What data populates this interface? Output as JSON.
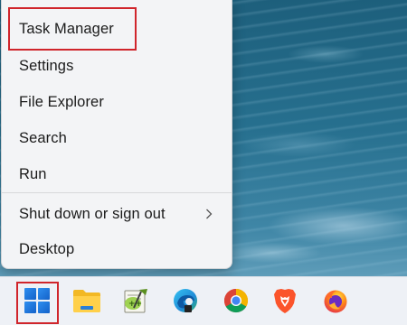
{
  "context_menu": {
    "items": [
      {
        "label": "Task Manager"
      },
      {
        "label": "Settings"
      },
      {
        "label": "File Explorer"
      },
      {
        "label": "Search"
      },
      {
        "label": "Run"
      },
      {
        "label": "Shut down or sign out",
        "icon": "chevron-right-icon"
      },
      {
        "label": "Desktop"
      }
    ],
    "highlighted_item": "Task Manager"
  },
  "taskbar": {
    "apps": [
      {
        "name": "Start",
        "icon": "windows-start-icon",
        "highlighted": true
      },
      {
        "name": "File Explorer",
        "icon": "folder-icon"
      },
      {
        "name": "Notepad++",
        "icon": "notepad-plus-plus-icon"
      },
      {
        "name": "Microsoft Edge",
        "icon": "edge-icon"
      },
      {
        "name": "Google Chrome",
        "icon": "chrome-icon"
      },
      {
        "name": "Brave",
        "icon": "brave-icon"
      },
      {
        "name": "Firefox",
        "icon": "firefox-icon"
      }
    ]
  },
  "colors": {
    "highlight_border": "#d0252b",
    "menu_background": "#f3f4f6",
    "taskbar_background": "#eef1f6",
    "windows_blue": "#1e6fd9"
  }
}
